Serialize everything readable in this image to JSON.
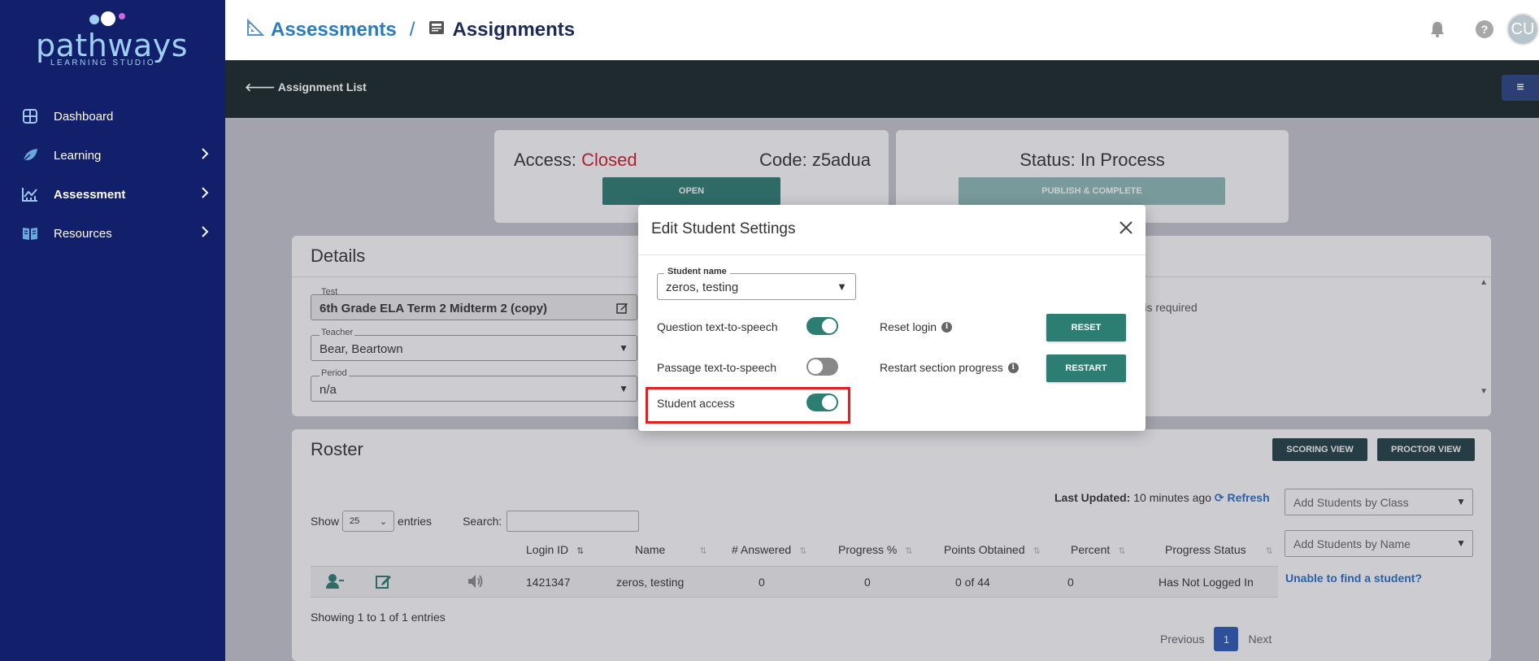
{
  "sidebar": {
    "logo_text": "pathways",
    "logo_subtext": "LEARNING STUDIO",
    "items": [
      {
        "label": "Dashboard",
        "icon": "dashboard-icon"
      },
      {
        "label": "Learning",
        "icon": "leaf-icon"
      },
      {
        "label": "Assessment",
        "icon": "chart-icon"
      },
      {
        "label": "Resources",
        "icon": "book-icon"
      }
    ]
  },
  "header": {
    "crumb1": "Assessments",
    "separator": "/",
    "crumb2": "Assignments",
    "avatar_initials": "CU",
    "help_glyph": "?"
  },
  "subbar": {
    "back_label": "Assignment List",
    "menu_glyph": "≡"
  },
  "access_card": {
    "access_label": "Access:",
    "access_value": "Closed",
    "code_text": "Code: z5adua",
    "open_button": "OPEN"
  },
  "status_card": {
    "status_text": "Status: In Process",
    "publish_button": "PUBLISH & COMPLETE"
  },
  "details": {
    "title": "Details",
    "test_label": "Test",
    "test_value": "6th Grade ELA Term 2 Midterm 2 (copy)",
    "teacher_label": "Teacher",
    "teacher_value": "Bear, Beartown",
    "period_label": "Period",
    "period_value": "n/a",
    "required_text": "er is required"
  },
  "roster": {
    "title": "Roster",
    "scoring_button": "SCORING VIEW",
    "proctor_button": "PROCTOR VIEW",
    "last_updated_label": "Last Updated:",
    "last_updated_value": "10 minutes ago",
    "refresh_label": "Refresh",
    "add_by_class": "Add Students by Class",
    "add_by_name": "Add Students by Name",
    "show_label": "Show",
    "entries_value": "25",
    "entries_label": "entries",
    "search_label": "Search:",
    "columns": [
      "Login ID",
      "Name",
      "# Answered",
      "Progress %",
      "Points Obtained",
      "Percent",
      "Progress Status"
    ],
    "rows": [
      {
        "login_id": "1421347",
        "name": "zeros, testing",
        "answered": "0",
        "progress": "0",
        "points": "0 of 44",
        "percent": "0",
        "status": "Has Not Logged In"
      }
    ],
    "unable_link": "Unable to find a student?",
    "showing_text": "Showing 1 to 1 of 1 entries",
    "prev_label": "Previous",
    "page_num": "1",
    "next_label": "Next"
  },
  "modal": {
    "title": "Edit Student Settings",
    "student_name_label": "Student name",
    "student_name_value": "zeros, testing",
    "question_tts_label": "Question text-to-speech",
    "question_tts_on": true,
    "passage_tts_label": "Passage text-to-speech",
    "passage_tts_on": false,
    "student_access_label": "Student access",
    "student_access_on": true,
    "reset_login_label": "Reset login",
    "reset_button": "RESET",
    "restart_label": "Restart section progress",
    "restart_button": "RESTART"
  },
  "colors": {
    "sidebar_bg": "#12206b",
    "teal": "#2d7e72",
    "closed_red": "#d21b2a",
    "link_blue": "#2a7bbf",
    "highlight": "#e02020"
  }
}
